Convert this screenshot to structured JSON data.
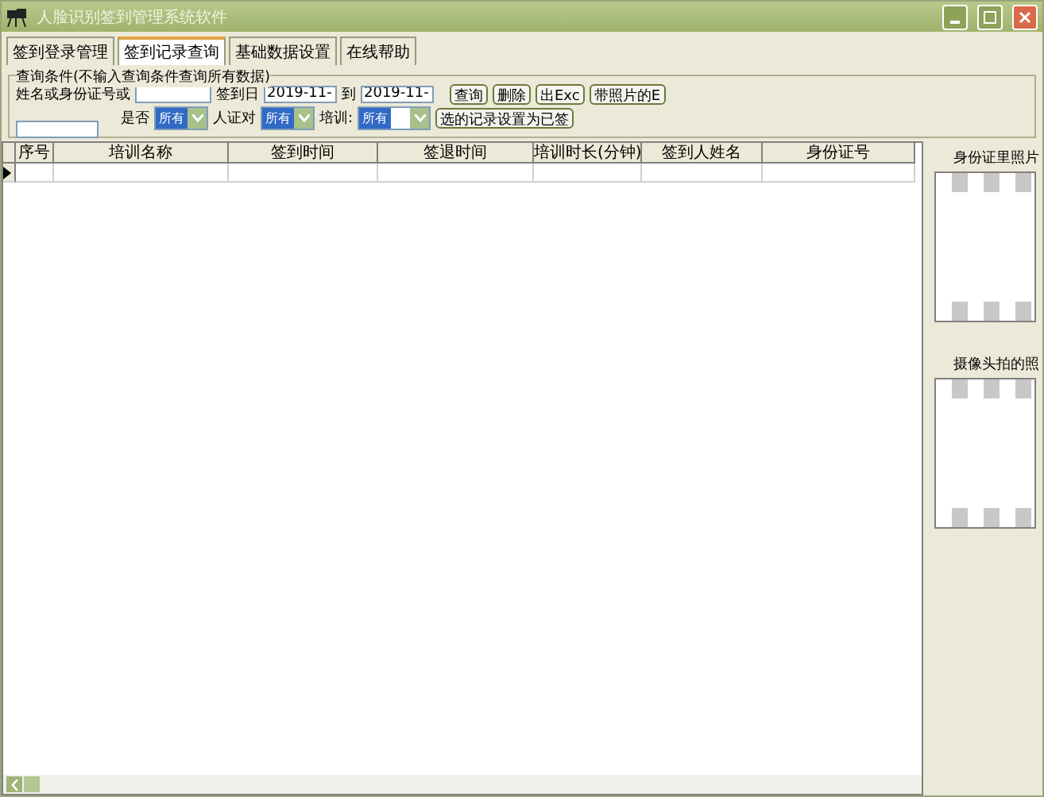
{
  "window": {
    "title": "人脸识别签到管理系统软件"
  },
  "tabs": [
    {
      "label": "签到登录管理",
      "selected": false
    },
    {
      "label": "签到记录查询",
      "selected": true
    },
    {
      "label": "基础数据设置",
      "selected": false
    },
    {
      "label": "在线帮助",
      "selected": false
    }
  ],
  "query": {
    "title": "查询条件(不输入查询条件查询所有数据)",
    "name_label": "姓名或身份证号或",
    "date_label": "签到日",
    "date_from": "2019-11-",
    "to_label": "到",
    "date_to": "2019-11-",
    "buttons": [
      "查询",
      "删除",
      "出Exc",
      "带照片的E"
    ],
    "filters": [
      {
        "label": "是否",
        "value": "所有"
      },
      {
        "label": "人证对",
        "value": "所有"
      },
      {
        "label": "培训:",
        "value": "所有"
      }
    ],
    "mark_button": "选的记录设置为已签"
  },
  "table": {
    "columns": [
      "序号",
      "培训名称",
      "签到时间",
      "签退时间",
      "培训时长(分钟)",
      "签到人姓名",
      "身份证号"
    ]
  },
  "photos": [
    {
      "title": "身份证里照片"
    },
    {
      "title": "摄像头拍的照"
    }
  ]
}
